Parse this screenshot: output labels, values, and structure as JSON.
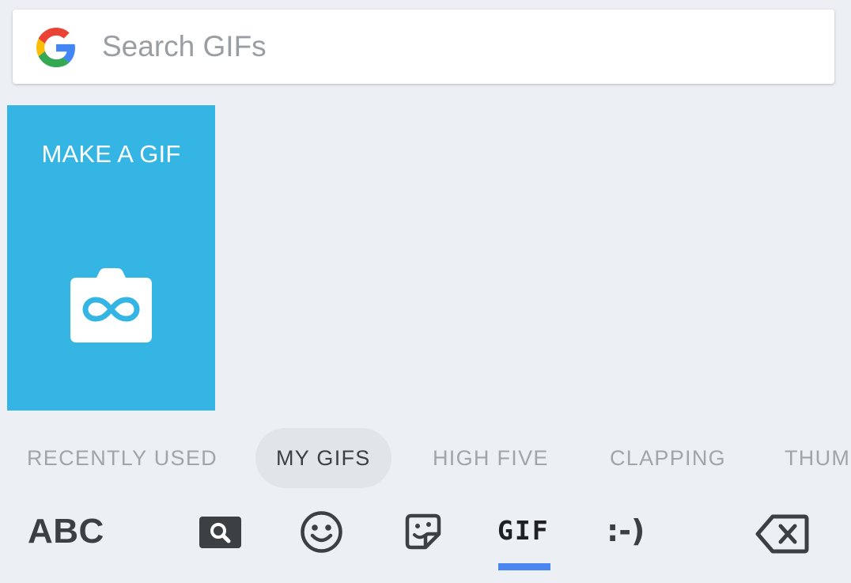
{
  "search": {
    "placeholder": "Search GIFs",
    "logo_icon": "google-g-icon"
  },
  "make_gif_tile": {
    "label": "MAKE A GIF",
    "icon": "camera-infinity-icon",
    "color": "#35b5e4"
  },
  "tabs": [
    {
      "label": "RECENTLY USED",
      "active": false
    },
    {
      "label": "MY GIFS",
      "active": true
    },
    {
      "label": "HIGH FIVE",
      "active": false
    },
    {
      "label": "CLAPPING",
      "active": false
    },
    {
      "label": "THUM",
      "active": false
    }
  ],
  "keyboard_bar": {
    "abc_label": "ABC",
    "search_icon": "search-key-icon",
    "emoji_icon": "smiley-icon",
    "sticker_icon": "sticker-icon",
    "gif_label": "GIF",
    "emoticon_label": ":-)",
    "backspace_icon": "backspace-icon",
    "indicator_color": "#4a86f0"
  }
}
